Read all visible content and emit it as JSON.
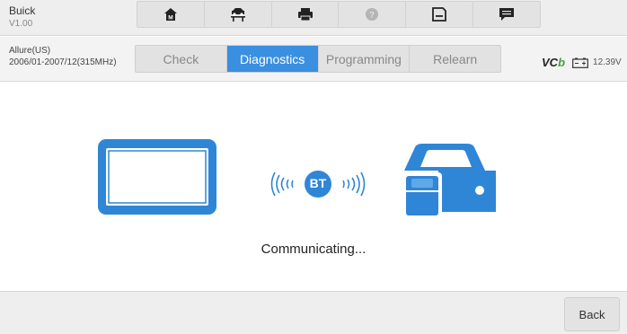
{
  "header": {
    "make": "Buick",
    "version": "V1.00",
    "toolbar": [
      {
        "icon": "home-icon"
      },
      {
        "icon": "vehicle-lift-icon"
      },
      {
        "icon": "print-icon"
      },
      {
        "icon": "help-icon"
      },
      {
        "icon": "save-icon"
      },
      {
        "icon": "message-icon"
      }
    ]
  },
  "vehicle": {
    "model": "Allure(US)",
    "years": "2006/01-2007/12(315MHz)"
  },
  "tabs": [
    {
      "label": "Check",
      "active": false
    },
    {
      "label": "Diagnostics",
      "active": true
    },
    {
      "label": "Programming",
      "active": false
    },
    {
      "label": "Relearn",
      "active": false
    }
  ],
  "vci": {
    "label": "VC",
    "mark": "b",
    "voltage": "12.39V"
  },
  "main": {
    "bt_label": "BT",
    "status": "Communicating..."
  },
  "footer": {
    "back_label": "Back"
  },
  "colors": {
    "accent": "#3a8fe0",
    "icon_blue": "#2f86d6",
    "vci_green": "#46a13d"
  }
}
